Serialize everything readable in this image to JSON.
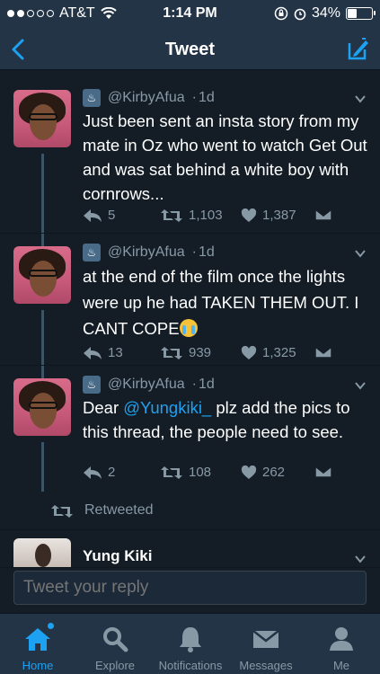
{
  "status_bar": {
    "carrier": "AT&T",
    "time": "1:14 PM",
    "battery_percent": "34%",
    "battery_level": 0.34
  },
  "nav": {
    "title": "Tweet"
  },
  "tweets": [
    {
      "handle": "@KirbyAfua",
      "time": "1d",
      "text": "Just been sent an insta story from my mate in Oz who went to watch Get Out and was sat behind a white boy with cornrows...",
      "replies": "5",
      "retweets": "1,103",
      "likes": "1,387"
    },
    {
      "handle": "@KirbyAfua",
      "time": "1d",
      "text": "at the end of the film once the lights were up he had TAKEN THEM OUT. I CANT COPE",
      "emoji": "crying-face",
      "replies": "13",
      "retweets": "939",
      "likes": "1,325"
    },
    {
      "handle": "@KirbyAfua",
      "time": "1d",
      "text_prefix": "Dear ",
      "mention": "@Yungkiki_",
      "text_suffix": " plz add the pics to this thread, the people need to see.",
      "replies": "2",
      "retweets": "108",
      "likes": "262"
    }
  ],
  "retweeted_label": "Retweeted",
  "next_tweet": {
    "name": "Yung Kiki"
  },
  "reply": {
    "placeholder": "Tweet your reply"
  },
  "tabs": [
    {
      "label": "Home",
      "active": true
    },
    {
      "label": "Explore"
    },
    {
      "label": "Notifications"
    },
    {
      "label": "Messages"
    },
    {
      "label": "Me"
    }
  ],
  "colors": {
    "accent": "#1da1f2",
    "background": "#141d26",
    "bar": "#243447",
    "muted": "#8899a6"
  }
}
